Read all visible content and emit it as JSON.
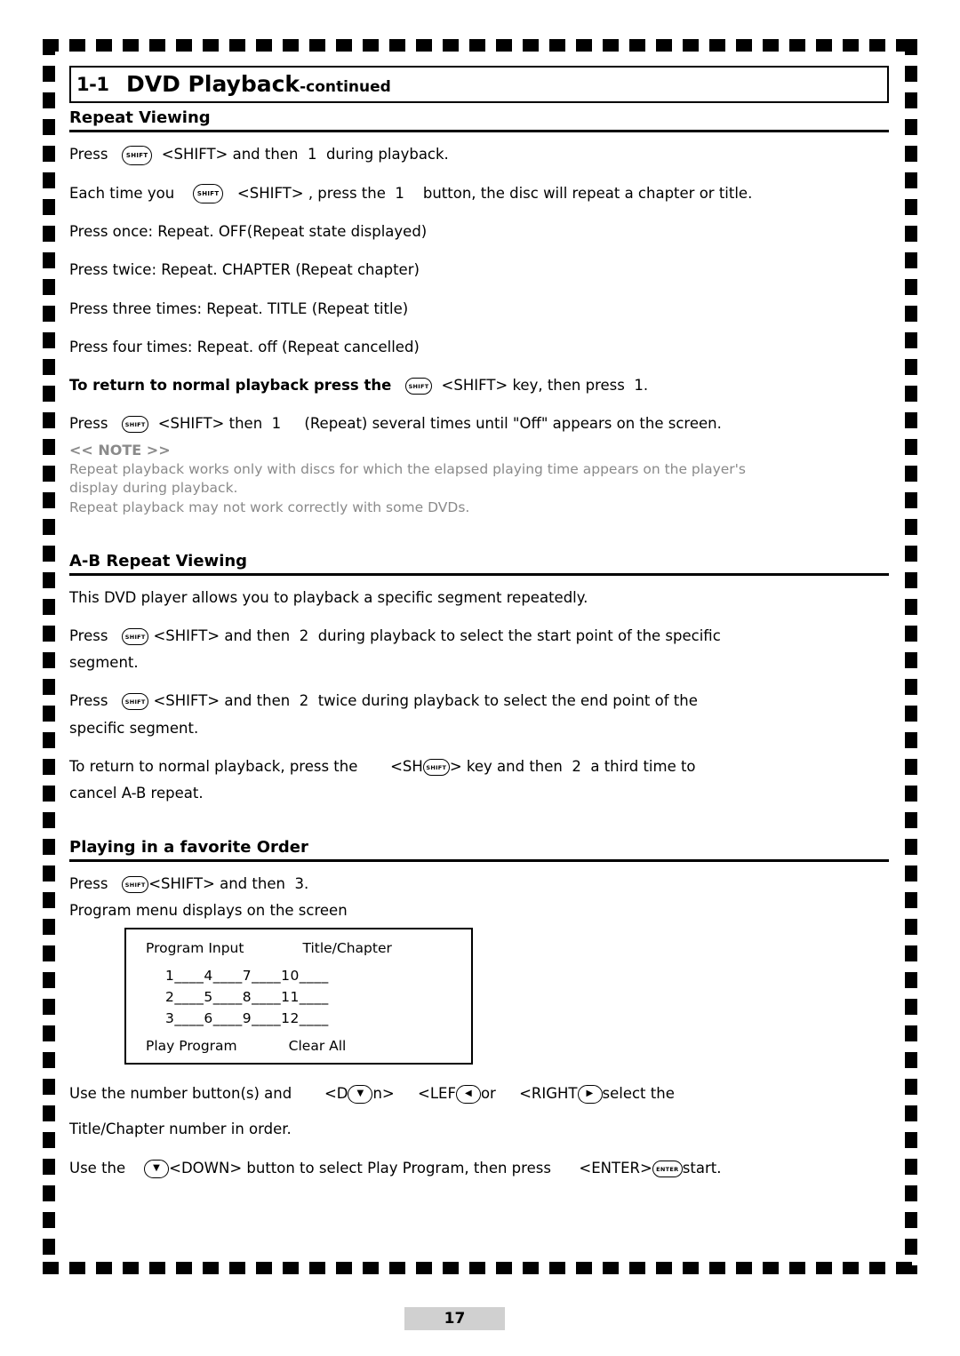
{
  "header": {
    "number": "1-1",
    "title": "DVD Playback",
    "continued": "-continued"
  },
  "sections": [
    {
      "id": "repeat_viewing",
      "heading": "Repeat Viewing"
    },
    {
      "id": "ab_repeat",
      "heading": "A-B Repeat Viewing"
    },
    {
      "id": "favorite_order",
      "heading": "Playing in a favorite Order"
    }
  ],
  "repeat_viewing": {
    "line1_a": "Press",
    "line1_key": "SHIFT",
    "line1_b": "<SHIFT> and then",
    "line1_num": "1",
    "line1_c": "during playback.",
    "line2_a": "Each time you",
    "line2_key": "SHIFT",
    "line2_b": "<SHIFT>  ,  press the",
    "line2_num": "1",
    "line2_c": "button, the disc will repeat a chapter or title.",
    "line3": "Press once: Repeat. OFF(Repeat state displayed)",
    "line4": "Press twice: Repeat. CHAPTER (Repeat chapter)",
    "line5": "Press three times: Repeat. TITLE (Repeat title)",
    "line6": "Press four times: Repeat. off (Repeat cancelled)",
    "line7_a": "To return to normal playback press the",
    "line7_key": "SHIFT",
    "line7_b": "<SHIFT> key, then press",
    "line7_num": "1",
    "line7_c": ".",
    "line8_a": "Press",
    "line8_key": "SHIFT",
    "line8_b": "<SHIFT> then",
    "line8_num": "1",
    "line8_c": "(Repeat) several times until \"Off\" appears on the screen.",
    "note_head": "<< NOTE >>",
    "note_line1": "Repeat playback works only with discs for which the elapsed playing time appears on the player's",
    "note_line2": "display during playback.",
    "note_line3": "Repeat playback may not work correctly with some DVDs."
  },
  "ab_repeat": {
    "line1": "This DVD player allows you to playback a specific segment repeatedly.",
    "line2_a": "Press",
    "line2_key": "SHIFT",
    "line2_b": "<SHIFT> and then",
    "line2_num": "2",
    "line2_c": "during playback to select the start point of the specific",
    "line2_d": "segment.",
    "line3_a": "Press",
    "line3_key": "SHIFT",
    "line3_b": "<SHIFT> and then",
    "line3_num": "2",
    "line3_c": "twice during playback to select the end point of the",
    "line3_d": "specific segment.",
    "line4_a": "To  return to normal playback, press the",
    "line4_b": "<SH",
    "line4_key": "SHIFT",
    "line4_c": "> key and then",
    "line4_num": "2",
    "line4_d": "a third time to",
    "line4_e": "cancel A-B repeat."
  },
  "favorite_order": {
    "line1_a": "Press",
    "line1_key": "SHIFT",
    "line1_b": "<SHIFT> and then",
    "line1_num": "3",
    "line1_c": ".",
    "line2": "Program menu displays on the screen",
    "program_menu": {
      "col1_head": "Program Input",
      "col2_head": "Title/Chapter",
      "rows": [
        "1____4____7____10____",
        "2____5____8____11____",
        "3____6____9____12____"
      ],
      "foot1": "Play Program",
      "foot2": "Clear All"
    },
    "line3_a": "Use the number button(s) and",
    "line3_b": "<D",
    "line3_key1": "▼",
    "line3_c": "n>",
    "line3_d": "<LEF",
    "line3_key2": "◀",
    "line3_e": "or",
    "line3_f": "<RIGHT",
    "line3_key3": "▶",
    "line3_g": "select the",
    "line4": "Title/Chapter number in order.",
    "line5_a": "Use the",
    "line5_key1": "▼",
    "line5_b": "<DOWN> button to select Play Program, then press",
    "line5_c": "<ENTER>",
    "line5_key2": "ENTER",
    "line5_d": "start."
  },
  "footer": {
    "page_number": "17"
  }
}
